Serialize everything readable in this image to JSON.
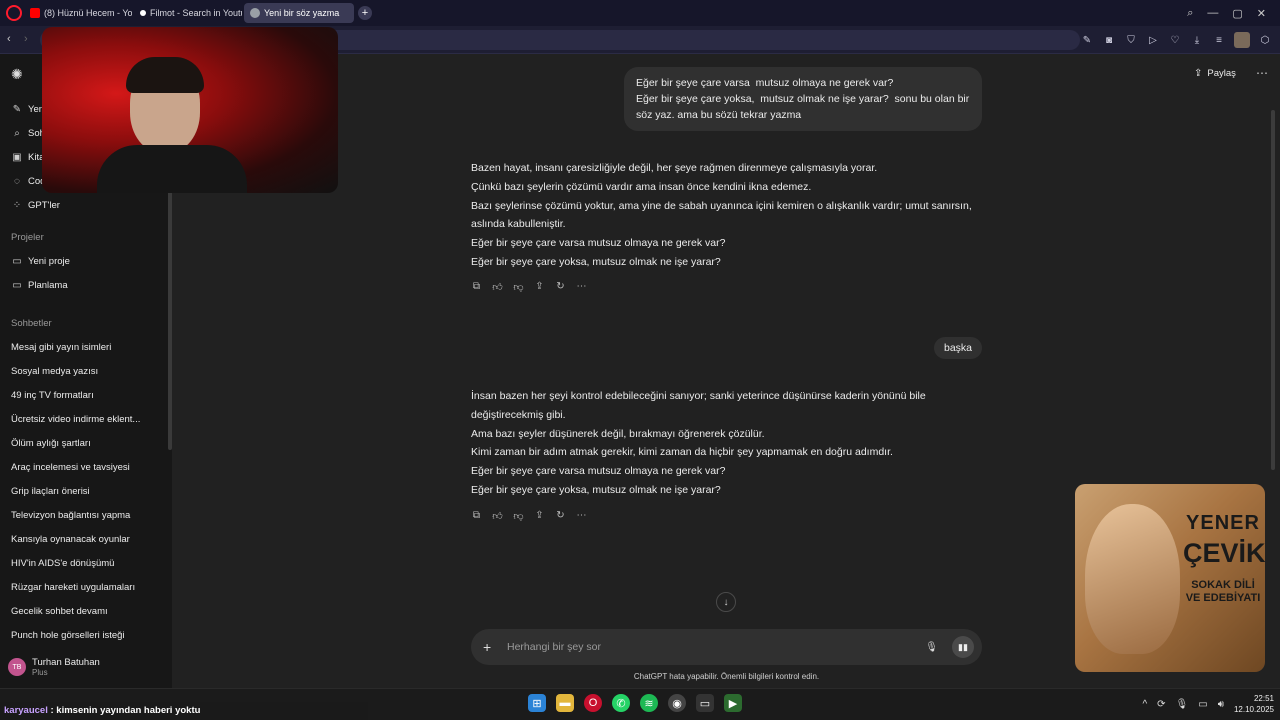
{
  "browser": {
    "tabs": [
      {
        "label": "(8) Hüznü Hecem - Yo",
        "icon_color": "#ff0000"
      },
      {
        "label": "Filmot - Search in Youtub",
        "icon_color": "#ffffff"
      },
      {
        "label": "Yeni bir söz yazma",
        "icon_color": "#9aa0a6"
      }
    ],
    "new_tab": "+",
    "window_controls": [
      "—",
      "▢",
      "✕"
    ]
  },
  "sidebar": {
    "items": [
      {
        "label": "Yeni sohbet",
        "icon": "new-chat-icon"
      },
      {
        "label": "Sohbetlerde ara",
        "icon": "search-icon"
      },
      {
        "label": "Kitaplık",
        "icon": "library-icon"
      },
      {
        "label": "Codex",
        "icon": "codex-icon"
      },
      {
        "label": "GPT'ler",
        "icon": "gpts-icon"
      }
    ],
    "projects_header": "Projeler",
    "projects": [
      {
        "label": "Yeni proje",
        "icon": "folder-plus-icon"
      },
      {
        "label": "Planlama",
        "icon": "folder-icon"
      }
    ],
    "chats_header": "Sohbetler",
    "chats": [
      "Mesaj gibi yayın isimleri",
      "Sosyal medya yazısı",
      "49 inç TV formatları",
      "Ücretsiz video indirme eklent...",
      "Ölüm aylığı şartları",
      "Araç incelemesi ve tavsiyesi",
      "Grip ilaçları önerisi",
      "Televizyon bağlantısı yapma",
      "Kansıyla oynanacak oyunlar",
      "HIV'in AIDS'e dönüşümü",
      "Rüzgar hareketi uygulamaları",
      "Gecelik sohbet devamı",
      "Punch hole görselleri isteği"
    ],
    "user": {
      "initials": "TB",
      "name": "Turhan Batuhan",
      "plan": "Plus"
    }
  },
  "header": {
    "share_label": "Paylaş"
  },
  "conversation": {
    "user_msg_1": [
      "Eğer bir şeye çare varsa  mutsuz olmaya ne gerek var?",
      "Eğer bir şeye çare yoksa,  mutsuz olmak ne işe yarar?  sonu bu olan bir",
      "söz yaz. ama bu sözü tekrar yazma"
    ],
    "reply_1": [
      "Bazen hayat, insanı çaresizliğiyle değil, her şeye rağmen direnmeye çalışmasıyla yorar.",
      "Çünkü bazı şeylerin çözümü vardır ama insan önce kendini ikna edemez.",
      "Bazı şeylerinse çözümü yoktur, ama yine de sabah uyanınca içini kemiren o alışkanlık vardır; umut sanırsın,",
      "aslında kabulleniştir.",
      "Eğer bir şeye çare varsa mutsuz olmaya ne gerek var?",
      "Eğer bir şeye çare yoksa, mutsuz olmak ne işe yarar?"
    ],
    "user_msg_2": "başka",
    "reply_2": [
      "İnsan bazen her şeyi kontrol edebileceğini sanıyor; sanki yeterince düşünürse kaderin yönünü bile",
      "değiştirecekmiş gibi.",
      "Ama bazı şeyler düşünerek değil, bırakmayı öğrenerek çözülür.",
      "Kimi zaman bir adım atmak gerekir, kimi zaman da hiçbir şey yapmamak en doğru adımdır.",
      "Eğer bir şeye çare varsa mutsuz olmaya ne gerek var?",
      "Eğer bir şeye çare yoksa, mutsuz olmak ne işe yarar?"
    ]
  },
  "composer": {
    "placeholder": "Herhangi bir şey sor"
  },
  "disclaimer": "ChatGPT hata yapabilir. Önemli bilgileri kontrol edin.",
  "poster": {
    "line1": "YENER",
    "line2": "ÇEVİK",
    "line3": "SOKAK DİLİ",
    "line4": "VE EDEBİYATI"
  },
  "ticker": {
    "user": "karyaucel",
    "message": ": kimsenin yayından haberi yoktu"
  },
  "clock": {
    "time": "22:51",
    "date": "12.10.2025"
  }
}
